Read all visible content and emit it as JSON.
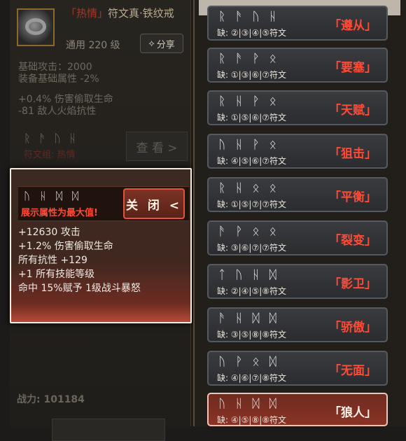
{
  "item": {
    "tag": "「热情」",
    "name": "符文真·铁纹戒",
    "meta": "通用 220 级",
    "share_label": "分享",
    "base_attack": "基础攻击：2000",
    "base_attr": "装备基础属性 -2%",
    "affix1": "+0.4% 伤害偷取生命",
    "affix2": "-81 敌人火焰抗性",
    "runes": [
      "ᚱ",
      "ᚫ",
      "ᚢ",
      "ᚺ"
    ],
    "rune_label": "符文组: 热情",
    "view_label": "查 看 >",
    "power": "战力: 101184"
  },
  "popup": {
    "runes": [
      "ᚢ",
      "ᚺ",
      "ᛞ",
      "ᛞ"
    ],
    "note": "展示属性为最大值!",
    "close_label": "关 闭 <",
    "stats": [
      "+12630 攻击",
      "+1.2% 伤害偷取生命",
      "所有抗性 +129",
      "+1 所有技能等级",
      "命中 15%赋予 1级战斗暴怒"
    ]
  },
  "rune_words": [
    {
      "runes": [
        "ᚱ",
        "ᚫ",
        "ᚢ",
        "ᚺ"
      ],
      "missing": "缺: ②|③|④|⑤符文",
      "name": "「遵从」",
      "selected": false
    },
    {
      "runes": [
        "ᚱ",
        "ᚫ",
        "ᚹ",
        "ᛟ"
      ],
      "missing": "缺: ①|③|⑥|⑦符文",
      "name": "「要塞」",
      "selected": false
    },
    {
      "runes": [
        "ᚱ",
        "ᚺ",
        "ᚹ",
        "ᛟ"
      ],
      "missing": "缺: ①|⑤|⑥|⑦符文",
      "name": "「天赋」",
      "selected": false
    },
    {
      "runes": [
        "ᚢ",
        "ᚺ",
        "ᚹ",
        "ᛟ"
      ],
      "missing": "缺: ④|⑤|⑥|⑦符文",
      "name": "「狙击」",
      "selected": false
    },
    {
      "runes": [
        "ᚱ",
        "ᚺ",
        "ᛟ",
        "ᛟ"
      ],
      "missing": "缺: ①|⑤|⑦|⑦符文",
      "name": "「平衡」",
      "selected": false
    },
    {
      "runes": [
        "ᚫ",
        "ᚹ",
        "ᛟ",
        "ᛟ"
      ],
      "missing": "缺: ③|⑥|⑦|⑦符文",
      "name": "「裂变」",
      "selected": false
    },
    {
      "runes": [
        "ᛏ",
        "ᚢ",
        "ᚺ",
        "ᛞ"
      ],
      "missing": "缺: ②|④|⑤|⑧符文",
      "name": "「影卫」",
      "selected": false
    },
    {
      "runes": [
        "ᚫ",
        "ᚺ",
        "ᛞ",
        "ᛞ"
      ],
      "missing": "缺: ③|⑤|⑧|⑧符文",
      "name": "「骄傲」",
      "selected": false
    },
    {
      "runes": [
        "ᚢ",
        "ᚹ",
        "ᛟ",
        "ᛞ"
      ],
      "missing": "缺: ④|⑥|⑦|⑧符文",
      "name": "「无面」",
      "selected": false
    },
    {
      "runes": [
        "ᚢ",
        "ᚺ",
        "ᛞ",
        "ᛞ"
      ],
      "missing": "缺: ④|⑤|⑧|⑧符文",
      "name": "「狼人」",
      "selected": true
    }
  ],
  "colors": {
    "accent_red": "#ff4a36",
    "selected_card": "#8a3325",
    "card_bg": "#3a3b3f"
  },
  "icons": {
    "share": "share-icon",
    "ring": "ring-icon"
  }
}
